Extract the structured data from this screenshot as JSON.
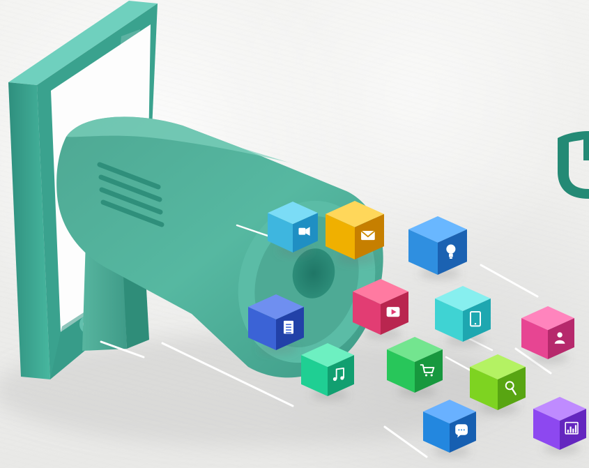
{
  "scene": {
    "colors": {
      "phone_frame": "#3aa28e",
      "phone_screen": "#ffffff",
      "megaphone_body": "#4eb59e",
      "megaphone_dark": "#2d8e7b",
      "megaphone_light": "#7bd3bf",
      "background": "#efefed"
    }
  },
  "cubes": [
    {
      "name": "camera-cube",
      "icon": "camera-icon",
      "color_main": "#3eb6df",
      "color_side": "#1f8fc3",
      "color_top": "#7bdcf6"
    },
    {
      "name": "mail-cube",
      "icon": "mail-icon",
      "color_main": "#f0b000",
      "color_side": "#c67f00",
      "color_top": "#ffd75a"
    },
    {
      "name": "lightbulb-cube",
      "icon": "lightbulb-icon",
      "color_main": "#2f8fe0",
      "color_side": "#1b62b2",
      "color_top": "#69b7ff"
    },
    {
      "name": "document-cube",
      "icon": "document-icon",
      "color_main": "#3b63d6",
      "color_side": "#2241a8",
      "color_top": "#6f8ff0"
    },
    {
      "name": "video-cube",
      "icon": "video-play-icon",
      "color_main": "#e23d73",
      "color_side": "#b9264f",
      "color_top": "#ff7aa1"
    },
    {
      "name": "tablet-cube",
      "icon": "tablet-icon",
      "color_main": "#3fd3d3",
      "color_side": "#1ea7b0",
      "color_top": "#87efef"
    },
    {
      "name": "user-cube",
      "icon": "user-icon",
      "color_main": "#e74592",
      "color_side": "#b6296c",
      "color_top": "#ff84bd"
    },
    {
      "name": "music-cube",
      "icon": "music-icon",
      "color_main": "#1fcf93",
      "color_side": "#119f70",
      "color_top": "#6df0c1"
    },
    {
      "name": "shopping-cart-cube",
      "icon": "shopping-cart-icon",
      "color_main": "#28c65a",
      "color_side": "#17983e",
      "color_top": "#73e58f"
    },
    {
      "name": "search-cube",
      "icon": "search-icon",
      "color_main": "#7ed321",
      "color_side": "#58a512",
      "color_top": "#b4f263"
    },
    {
      "name": "chat-cube",
      "icon": "chat-icon",
      "color_main": "#2387df",
      "color_side": "#165fb1",
      "color_top": "#69b1ff"
    },
    {
      "name": "chart-cube",
      "icon": "bar-chart-icon",
      "color_main": "#8d48f0",
      "color_side": "#6426bf",
      "color_top": "#bf8bff"
    }
  ]
}
